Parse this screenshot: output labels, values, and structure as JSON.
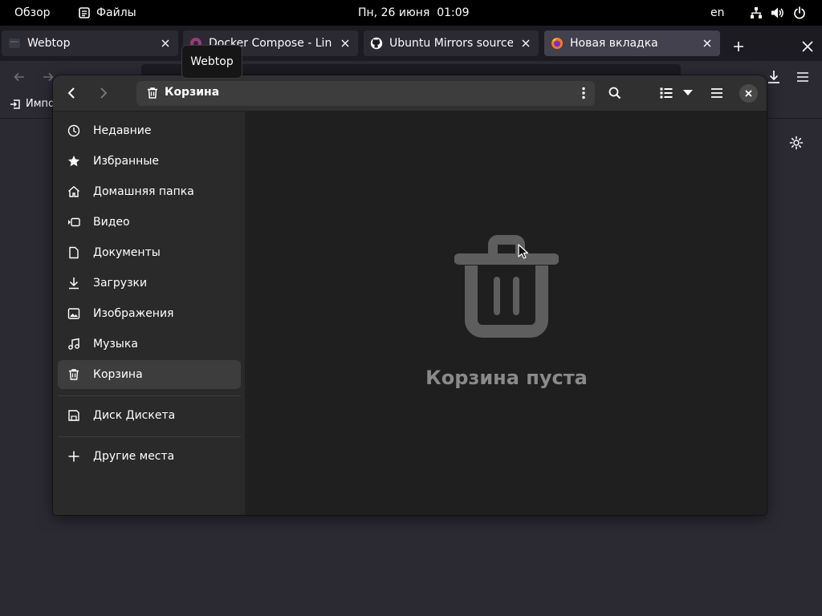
{
  "topbar": {
    "activities": "Обзор",
    "app_name": "Файлы",
    "clock": "Пн, 26 июня  01:09",
    "lang": "en"
  },
  "browser": {
    "tabs": [
      {
        "title": "Webtop",
        "icon": "webtop-icon",
        "active": false
      },
      {
        "title": "Docker Compose - LinuxS",
        "icon": "linuxserver-icon",
        "active": false
      },
      {
        "title": "Ubuntu Mirrors sources.lis",
        "icon": "github-icon",
        "active": false
      },
      {
        "title": "Новая вкладка",
        "icon": "firefox-icon",
        "active": true
      }
    ],
    "tooltip": "Webtop",
    "bookmark_import": "Импо"
  },
  "files": {
    "path_label": "Корзина",
    "sidebar": {
      "places": [
        {
          "label": "Недавние",
          "icon": "clock-icon"
        },
        {
          "label": "Избранные",
          "icon": "star-icon"
        },
        {
          "label": "Домашняя папка",
          "icon": "home-icon"
        },
        {
          "label": "Видео",
          "icon": "video-icon"
        },
        {
          "label": "Документы",
          "icon": "document-icon"
        },
        {
          "label": "Загрузки",
          "icon": "download-icon"
        },
        {
          "label": "Изображения",
          "icon": "image-icon"
        },
        {
          "label": "Музыка",
          "icon": "music-icon"
        },
        {
          "label": "Корзина",
          "icon": "trash-icon",
          "selected": true
        }
      ],
      "devices": [
        {
          "label": "Диск Дискета",
          "icon": "floppy-icon"
        }
      ],
      "other": [
        {
          "label": "Другие места",
          "icon": "plus-icon"
        }
      ]
    },
    "empty_message": "Корзина пуста"
  },
  "colors": {
    "topbar_bg": "#000000",
    "window_bg": "#242424",
    "headerbar_bg": "#303030",
    "sidebar_bg": "#2a2a2a",
    "content_bg": "#1f1f1f",
    "selected_bg": "#3d3d3d",
    "empty_icon": "#5e5e5e",
    "active_tab_bg": "#42414d"
  }
}
